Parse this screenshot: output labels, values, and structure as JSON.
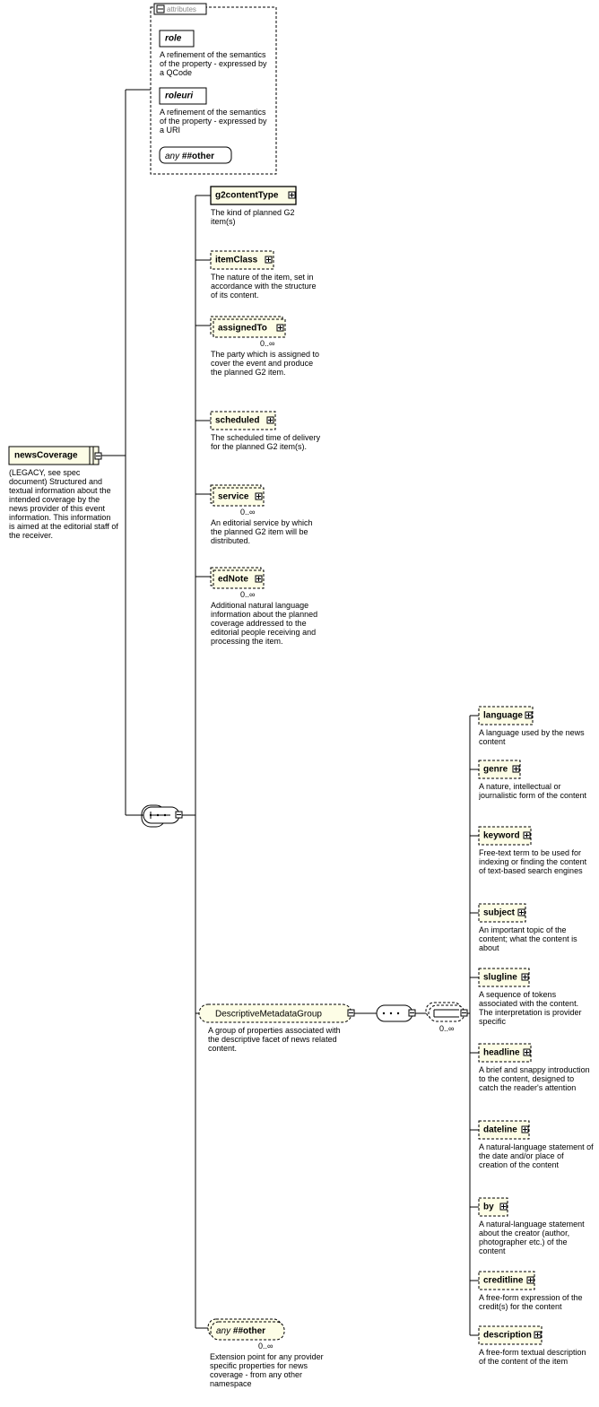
{
  "attributes": {
    "header": "attributes",
    "items": [
      {
        "name": "role",
        "desc": "A refinement of the semantics of the property - expressed by a QCode"
      },
      {
        "name": "roleuri",
        "desc": "A refinement of the semantics of the property - expressed by a URI"
      }
    ],
    "any": "any ##other"
  },
  "root": {
    "name": "newsCoverage",
    "desc": "(LEGACY, see spec document) Structured and textual information about the intended coverage by the news provider of this event information. This information is aimed at the editorial staff of the receiver."
  },
  "seq1": [
    {
      "name": "g2contentType",
      "desc": "The kind of planned G2 item(s)",
      "card": ""
    },
    {
      "name": "itemClass",
      "desc": "The nature of the item, set in accordance with the structure of its content.",
      "card": ""
    },
    {
      "name": "assignedTo",
      "desc": "The party which is assigned to cover the event and produce the planned G2 item.",
      "card": "0..∞"
    },
    {
      "name": "scheduled",
      "desc": "The scheduled time of delivery for the planned G2 item(s).",
      "card": ""
    },
    {
      "name": "service",
      "desc": "An editorial service by which the planned G2 item will be distributed.",
      "card": "0..∞"
    },
    {
      "name": "edNote",
      "desc": "Additional natural language information about the planned coverage addressed to the editorial people receiving and processing the item.",
      "card": "0..∞"
    }
  ],
  "dmg": {
    "name": "DescriptiveMetadataGroup",
    "desc": "A group of properties associated with the descriptive facet of news related content.",
    "card": "0..∞",
    "children": [
      {
        "name": "language",
        "desc": "A language used by the news content"
      },
      {
        "name": "genre",
        "desc": "A nature, intellectual or journalistic form of the content"
      },
      {
        "name": "keyword",
        "desc": "Free-text term to be used for indexing or finding the content of text-based search engines"
      },
      {
        "name": "subject",
        "desc": "An important topic of the content; what the content is about"
      },
      {
        "name": "slugline",
        "desc": "A sequence of tokens associated with the content. The interpretation is provider specific"
      },
      {
        "name": "headline",
        "desc": "A brief and snappy introduction to the content, designed to catch the reader's attention"
      },
      {
        "name": "dateline",
        "desc": "A natural-language statement of the date and/or place of creation of the content"
      },
      {
        "name": "by",
        "desc": "A natural-language statement about the creator (author, photographer etc.) of the content"
      },
      {
        "name": "creditline",
        "desc": "A free-form expression of the credit(s) for the content"
      },
      {
        "name": "description",
        "desc": "A free-form textual description of the content of the item"
      }
    ]
  },
  "anyOther": {
    "name": "any ##other",
    "card": "0..∞",
    "desc": "Extension point for any provider specific properties for news coverage - from any other namespace"
  }
}
